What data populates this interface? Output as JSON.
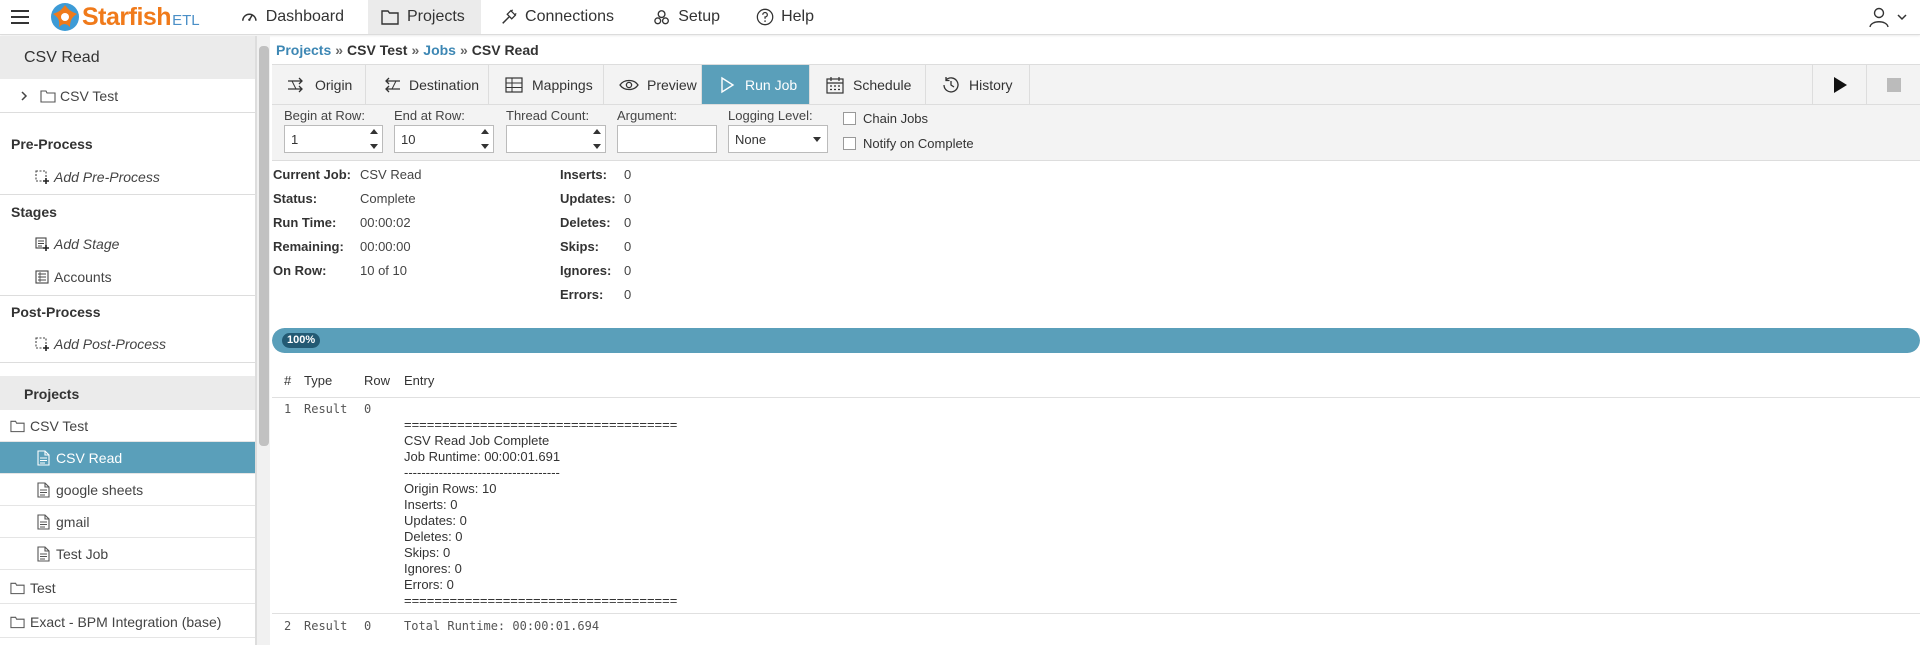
{
  "nav": {
    "brand": "Starfish",
    "brand_suffix": "ETL",
    "items": [
      {
        "label": "Dashboard",
        "icon": "dashboard-icon"
      },
      {
        "label": "Projects",
        "icon": "folder-icon"
      },
      {
        "label": "Connections",
        "icon": "plug-icon"
      },
      {
        "label": "Setup",
        "icon": "gears-icon"
      },
      {
        "label": "Help",
        "icon": "question-icon"
      }
    ],
    "active": "Projects"
  },
  "sidebar": {
    "title": "CSV Read",
    "tree_root": "CSV Test",
    "pre_process_header": "Pre-Process",
    "add_pre_process": "Add Pre-Process",
    "stages_header": "Stages",
    "add_stage": "Add Stage",
    "stage_items": [
      "Accounts"
    ],
    "post_process_header": "Post-Process",
    "add_post_process": "Add Post-Process",
    "projects_header": "Projects",
    "projects": [
      {
        "label": "CSV Test",
        "kind": "folder"
      },
      {
        "label": "CSV Read",
        "kind": "job",
        "selected": true
      },
      {
        "label": "google sheets",
        "kind": "job"
      },
      {
        "label": "gmail",
        "kind": "job"
      },
      {
        "label": "Test Job",
        "kind": "job"
      },
      {
        "label": "Test",
        "kind": "folder"
      },
      {
        "label": "Exact - BPM Integration (base)",
        "kind": "folder"
      }
    ]
  },
  "breadcrumb": {
    "projects": "Projects",
    "project": "CSV Test",
    "jobs": "Jobs",
    "current": "CSV Read",
    "separator": "»"
  },
  "tabs": {
    "origin": "Origin",
    "destination": "Destination",
    "mappings": "Mappings",
    "preview": "Preview",
    "run_job": "Run Job",
    "schedule": "Schedule",
    "history": "History",
    "active": "Run Job"
  },
  "options": {
    "begin_label": "Begin at Row:",
    "begin_value": "1",
    "end_label": "End at Row:",
    "end_value": "10",
    "thread_label": "Thread Count:",
    "thread_value": "",
    "argument_label": "Argument:",
    "argument_value": "",
    "logging_label": "Logging Level:",
    "logging_value": "None",
    "chain_jobs": "Chain Jobs",
    "notify_on_complete": "Notify on Complete"
  },
  "status": {
    "current_job_label": "Current Job:",
    "current_job": "CSV Read",
    "status_label": "Status:",
    "status": "Complete",
    "run_time_label": "Run Time:",
    "run_time": "00:00:02",
    "remaining_label": "Remaining:",
    "remaining": "00:00:00",
    "on_row_label": "On Row:",
    "on_row": "10 of 10",
    "inserts_label": "Inserts:",
    "inserts": "0",
    "updates_label": "Updates:",
    "updates": "0",
    "deletes_label": "Deletes:",
    "deletes": "0",
    "skips_label": "Skips:",
    "skips": "0",
    "ignores_label": "Ignores:",
    "ignores": "0",
    "errors_label": "Errors:",
    "errors": "0"
  },
  "progress": {
    "percent": 100,
    "label": "100%"
  },
  "log": {
    "headers": {
      "num": "#",
      "type": "Type",
      "row": "Row",
      "entry": "Entry"
    },
    "rows": [
      {
        "num": "1",
        "type": "Result",
        "row": "0",
        "entry": "====================================\nCSV Read Job Complete\nJob Runtime: 00:00:01.691\n------------------------------------\nOrigin Rows: 10\nInserts: 0\nUpdates: 0\nDeletes: 0\nSkips: 0\nIgnores: 0\nErrors: 0\n===================================="
      },
      {
        "num": "2",
        "type": "Result",
        "row": "0",
        "entry": "Total Runtime: 00:00:01.694"
      }
    ]
  },
  "colors": {
    "accent": "#5a9fba",
    "brand_orange": "#f07a1a",
    "link": "#3d87b4"
  }
}
